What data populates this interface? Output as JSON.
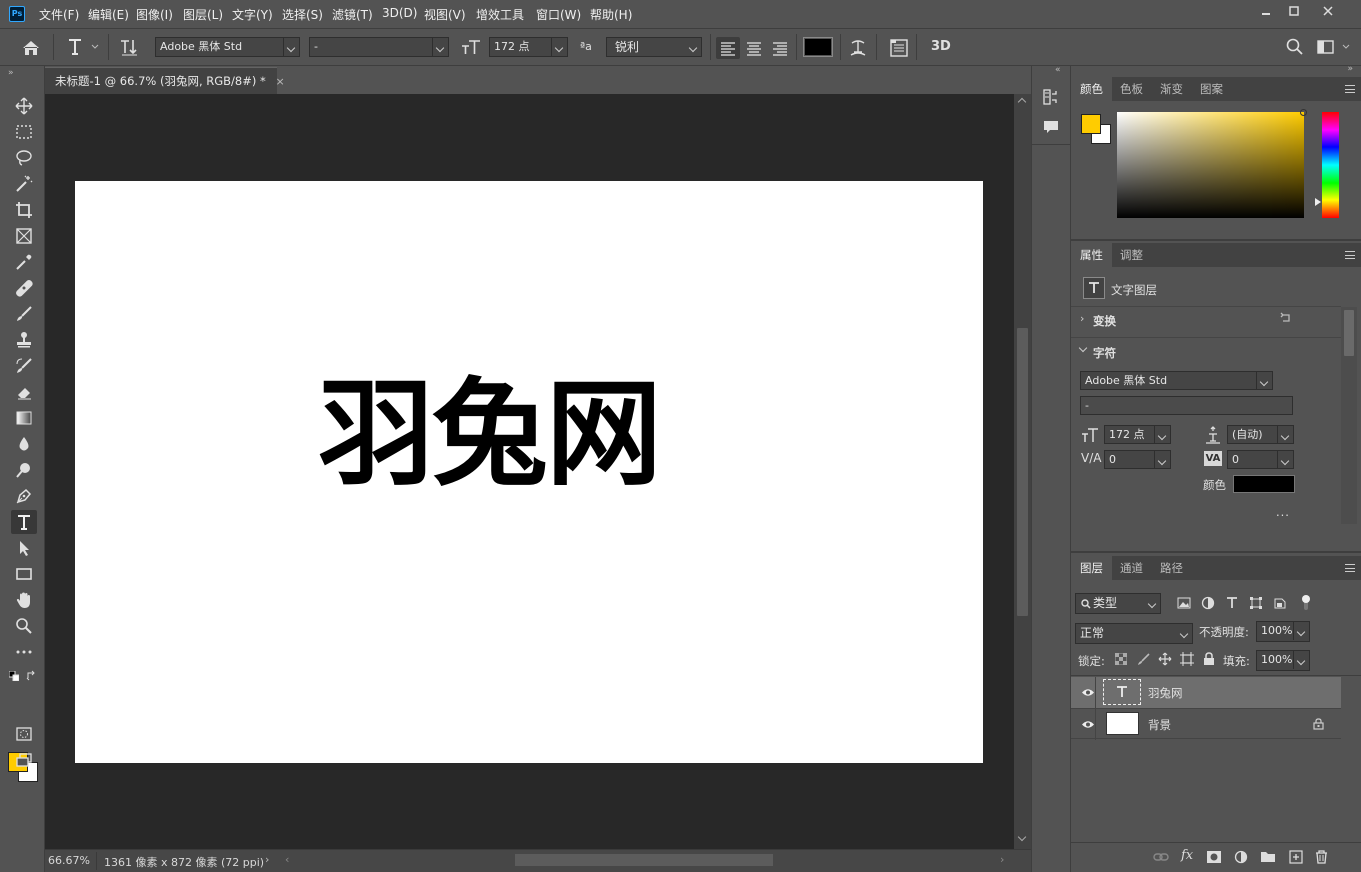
{
  "app": {
    "logo": "Ps"
  },
  "menu": [
    "文件(F)",
    "编辑(E)",
    "图像(I)",
    "图层(L)",
    "文字(Y)",
    "选择(S)",
    "滤镜(T)",
    "3D(D)",
    "视图(V)",
    "增效工具",
    "窗口(W)",
    "帮助(H)"
  ],
  "options": {
    "font_family": "Adobe 黑体 Std",
    "font_style": "-",
    "font_size": "172 点",
    "antialias_icon": "ªa",
    "antialias": "锐利",
    "warp_3d": "3D"
  },
  "document": {
    "tab_title": "未标题-1 @ 66.7% (羽兔网, RGB/8#) *",
    "canvas_text": "羽兔网",
    "zoom": "66.67%",
    "doc_info": "1361 像素 x 872 像素 (72 ppi)"
  },
  "colors": {
    "foreground": "#FFCC00",
    "background": "#FFFFFF",
    "text_color": "#000000",
    "accent": "#31A8FF"
  },
  "color_panel": {
    "tabs": [
      "颜色",
      "色板",
      "渐变",
      "图案"
    ]
  },
  "properties_panel": {
    "tabs": [
      "属性",
      "调整"
    ],
    "layer_kind": "文字图层",
    "transform": "变换",
    "character": "字符",
    "font_family": "Adobe 黑体 Std",
    "font_style": "-",
    "font_size": "172 点",
    "leading": "(自动)",
    "kerning": "0",
    "tracking": "0",
    "color_label": "颜色",
    "more": "..."
  },
  "layers_panel": {
    "tabs": [
      "图层",
      "通道",
      "路径"
    ],
    "filter": "类型",
    "blend_mode": "正常",
    "opacity_label": "不透明度:",
    "opacity": "100%",
    "lock_label": "锁定:",
    "fill_label": "填充:",
    "fill": "100%",
    "layers": [
      {
        "name": "羽兔网",
        "type": "text",
        "selected": true
      },
      {
        "name": "背景",
        "type": "background",
        "locked": true
      }
    ]
  }
}
